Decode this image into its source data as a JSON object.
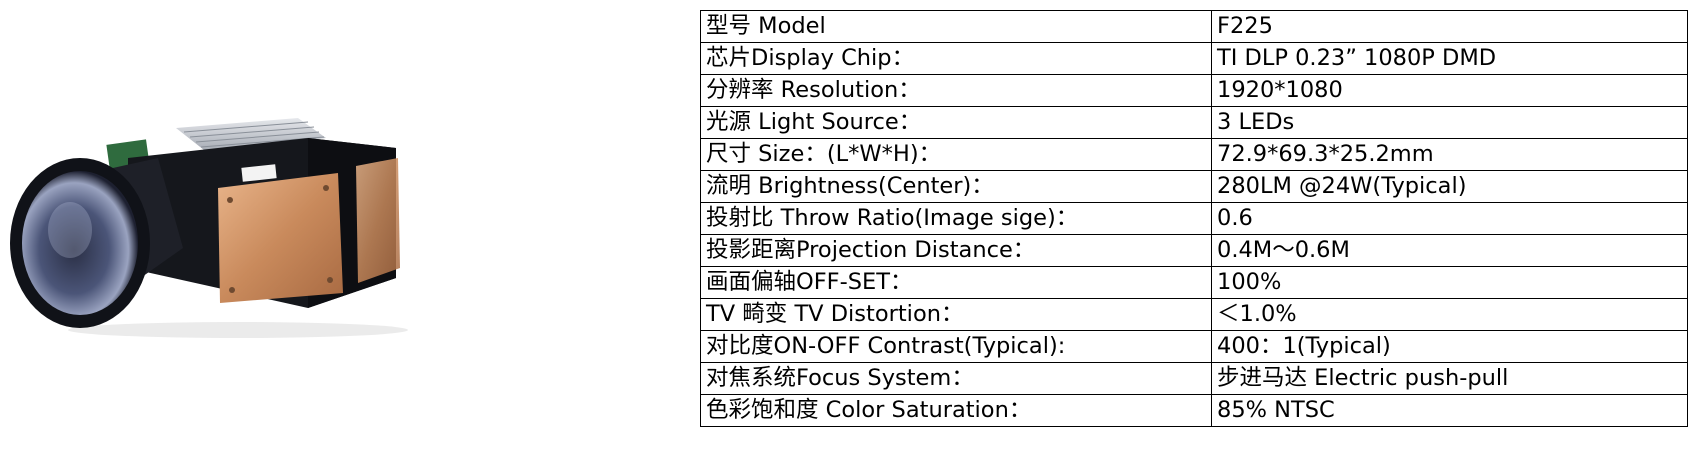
{
  "specs": [
    {
      "label": "型号 Model",
      "value": "F225"
    },
    {
      "label": "芯片Display Chip：",
      "value": "TI DLP 0.23” 1080P DMD"
    },
    {
      "label": "分辨率  Resolution：",
      "value": "1920*1080"
    },
    {
      "label": "光源 Light Source：",
      "value": "3 LEDs"
    },
    {
      "label": "尺寸 Size：(L*W*H)：",
      "value": "72.9*69.3*25.2mm"
    },
    {
      "label": "流明 Brightness(Center)：",
      "value": "280LM @24W(Typical)"
    },
    {
      "label": "投射比 Throw Ratio(Image sige)：",
      "value": "0.6"
    },
    {
      "label": "投影距离Projection Distance：",
      "value": "0.4M～0.6M"
    },
    {
      "label": "画面偏轴OFF-SET：",
      "value": "100%"
    },
    {
      "label": "TV 畸变 TV Distortion：",
      "value": "＜1.0%"
    },
    {
      "label": "对比度ON-OFF Contrast(Typical):",
      "value": "400：1(Typical)"
    },
    {
      "label": "对焦系统Focus System：",
      "value": "步进马达 Electric push-pull"
    },
    {
      "label": "色彩饱和度 Color Saturation：",
      "value": "85% NTSC"
    }
  ]
}
